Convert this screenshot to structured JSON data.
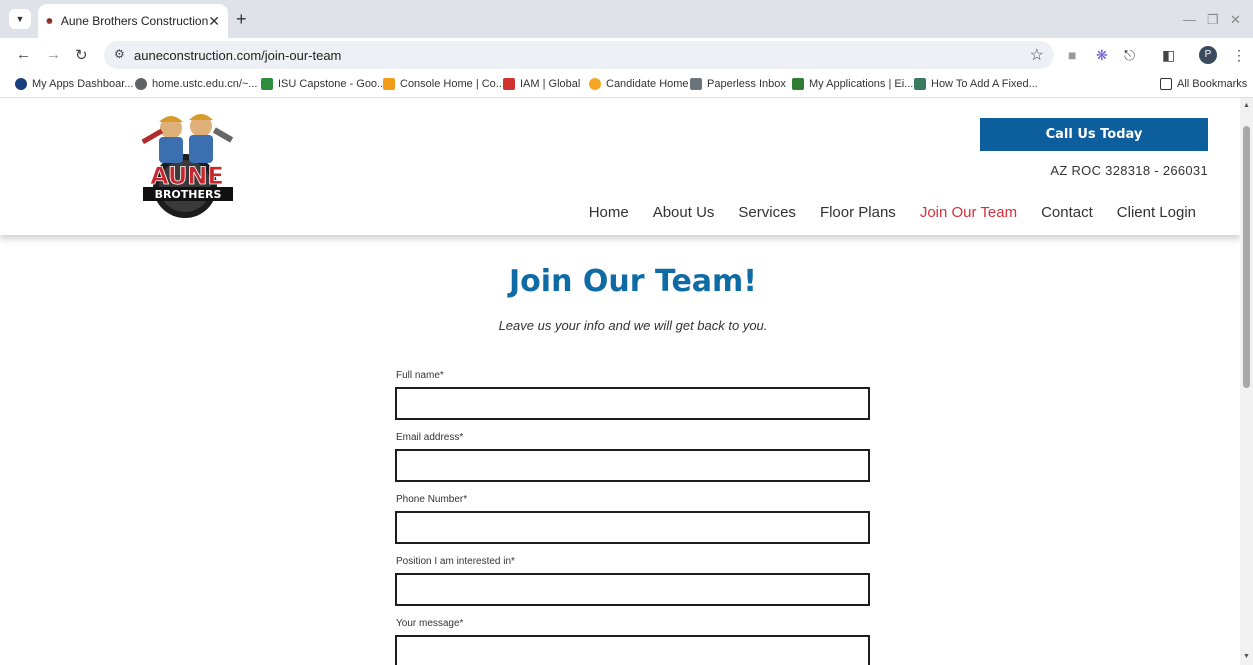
{
  "browser": {
    "tab_title": "Aune Brothers Construction",
    "url": "auneconstruction.com/join-our-team",
    "profile_initial": "P",
    "bookmarks": [
      {
        "label": "My Apps Dashboar...",
        "color": "#1a3d7c"
      },
      {
        "label": "home.ustc.edu.cn/~...",
        "color": "#5f6368"
      },
      {
        "label": "ISU Capstone - Goo...",
        "color": "#2d8f3b"
      },
      {
        "label": "Console Home | Co...",
        "color": "#f29a1a"
      },
      {
        "label": "IAM | Global",
        "color": "#d0312d"
      },
      {
        "label": "Candidate Home",
        "color": "#f5a623"
      },
      {
        "label": "Paperless Inbox",
        "color": "#6c757d"
      },
      {
        "label": "My Applications | Ei...",
        "color": "#2e7d32"
      },
      {
        "label": "How To Add A Fixed...",
        "color": "#3c7a5e"
      }
    ],
    "all_bookmarks": "All Bookmarks"
  },
  "header": {
    "call_button": "Call Us Today",
    "roc": "AZ ROC 328318 - 266031",
    "logo_text_top": "AUNE",
    "logo_text_bottom": "BROTHERS",
    "nav": [
      {
        "label": "Home",
        "active": false
      },
      {
        "label": "About Us",
        "active": false
      },
      {
        "label": "Services",
        "active": false
      },
      {
        "label": "Floor Plans",
        "active": false
      },
      {
        "label": "Join Our Team",
        "active": true
      },
      {
        "label": "Contact",
        "active": false
      },
      {
        "label": "Client Login",
        "active": false
      }
    ]
  },
  "main": {
    "title": "Join Our Team!",
    "subtitle": "Leave us your info and we will get back to you.",
    "fields": [
      {
        "label": "Full name*",
        "value": ""
      },
      {
        "label": "Email address*",
        "value": ""
      },
      {
        "label": "Phone Number*",
        "value": ""
      },
      {
        "label": "Position I am interested in*",
        "value": ""
      },
      {
        "label": "Your message*",
        "value": ""
      }
    ]
  },
  "colors": {
    "brand_blue": "#0e6ba6",
    "button_blue": "#0d5e9c",
    "active_nav": "#d72f3c"
  }
}
